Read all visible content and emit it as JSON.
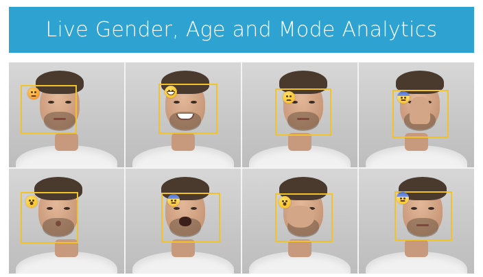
{
  "banner": {
    "title": "Live Gender, Age and Mode Analytics",
    "background": "#2ea3d2",
    "text_color": "#ffffff"
  },
  "detection": {
    "box_color": "#f2c22b"
  },
  "tiles": [
    {
      "expression": "angry-icon"
    },
    {
      "expression": "grinning-icon"
    },
    {
      "expression": "sad-icon"
    },
    {
      "expression": "fearful-icon"
    },
    {
      "expression": "surprised-icon"
    },
    {
      "expression": "fearful-icon"
    },
    {
      "expression": "surprised-icon"
    },
    {
      "expression": "fearful-icon"
    }
  ]
}
